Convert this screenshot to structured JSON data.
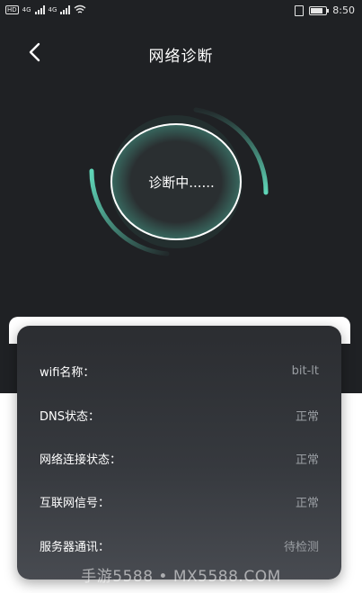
{
  "status": {
    "left_badge": "HD",
    "net1": "4G",
    "net2": "4G",
    "time": "8:50"
  },
  "header": {
    "title": "网络诊断"
  },
  "diagnosis": {
    "status_text": "诊断中......"
  },
  "info": {
    "rows": [
      {
        "label": "wifi名称：",
        "value": "bit-lt"
      },
      {
        "label": "DNS状态：",
        "value": "正常"
      },
      {
        "label": "网络连接状态：",
        "value": "正常"
      },
      {
        "label": "互联网信号：",
        "value": "正常"
      },
      {
        "label": "服务器通讯：",
        "value": "待检测"
      }
    ]
  },
  "watermark": "手游5588 • MX5588.COM",
  "colors": {
    "background_dark": "#1f2124",
    "accent_teal": "#5fd6b8",
    "text_muted": "#9a9ea3"
  },
  "icons": {
    "back": "chevron-left-icon",
    "wifi": "wifi-icon",
    "battery": "battery-icon",
    "vibrate": "vibrate-icon"
  }
}
